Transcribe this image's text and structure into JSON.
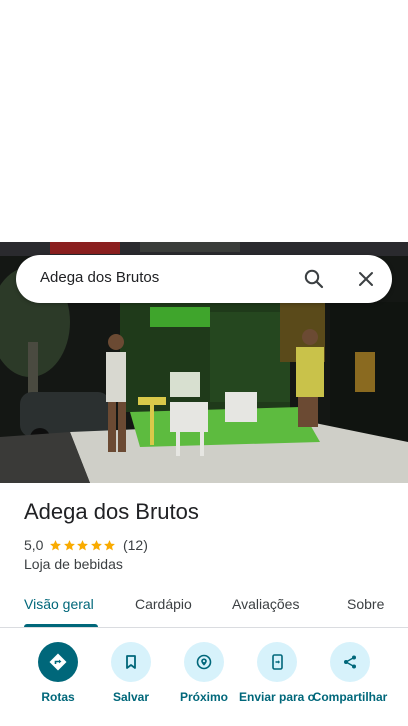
{
  "search": {
    "query": "Adega dos Brutos"
  },
  "place": {
    "name": "Adega dos Brutos",
    "rating": "5,0",
    "stars": 5,
    "review_count": "(12)",
    "category": "Loja de bebidas"
  },
  "tabs": [
    {
      "label": "Visão geral",
      "active": true
    },
    {
      "label": "Cardápio",
      "active": false
    },
    {
      "label": "Avaliações",
      "active": false
    },
    {
      "label": "Sobre",
      "active": false
    }
  ],
  "actions": [
    {
      "label": "Rotas",
      "icon": "directions-icon",
      "primary": true
    },
    {
      "label": "Salvar",
      "icon": "bookmark-icon",
      "primary": false
    },
    {
      "label": "Próximo",
      "icon": "nearby-icon",
      "primary": false
    },
    {
      "label": "Enviar para o",
      "icon": "send-to-phone-icon",
      "primary": false
    },
    {
      "label": "Compartilhar",
      "icon": "share-icon",
      "primary": false
    }
  ],
  "colors": {
    "accent": "#00677a",
    "action_bg": "#d7f2fb",
    "star": "#f9ab00"
  }
}
